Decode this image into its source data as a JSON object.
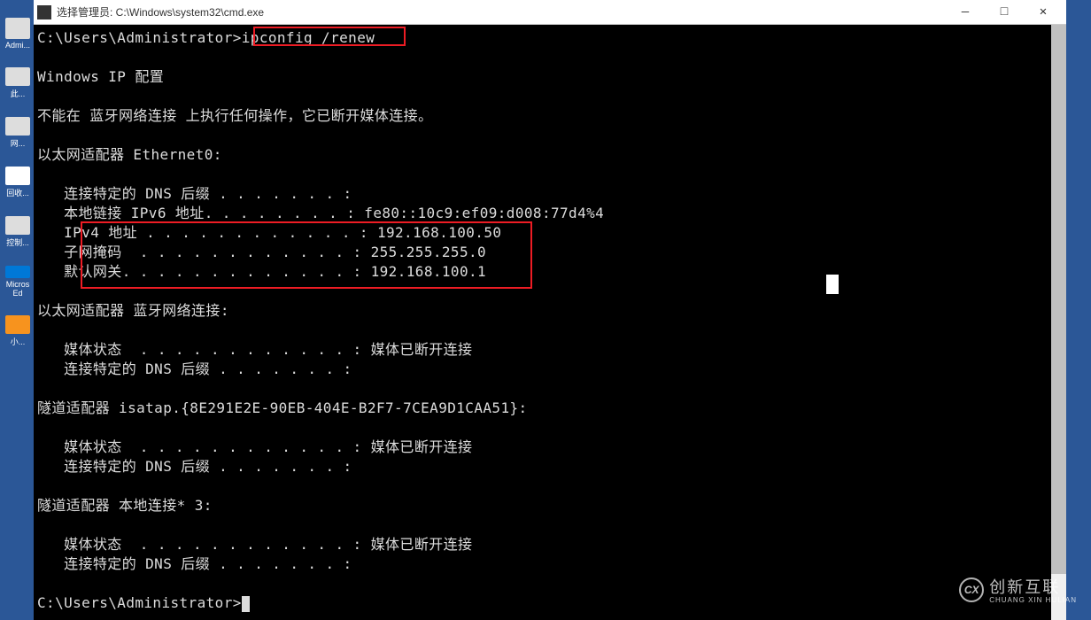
{
  "window": {
    "title": "选择管理员: C:\\Windows\\system32\\cmd.exe",
    "minimize_label": "—",
    "maximize_label": "□",
    "close_label": "✕"
  },
  "desktop": {
    "icons": [
      {
        "label": "Admi..."
      },
      {
        "label": "此..."
      },
      {
        "label": "网..."
      },
      {
        "label": "回收..."
      },
      {
        "label": "控制..."
      },
      {
        "label": "Micros\nEd"
      },
      {
        "label": "小..."
      }
    ]
  },
  "terminal": {
    "prompt1": "C:\\Users\\Administrator>",
    "command1": "ipconfig /renew",
    "blank1": "",
    "header": "Windows IP 配置",
    "blank2": "",
    "error_line": "不能在 蓝牙网络连接 上执行任何操作，它已断开媒体连接。",
    "blank3": "",
    "adapter1_title": "以太网适配器 Ethernet0:",
    "blank4": "",
    "adapter1_dns": "   连接特定的 DNS 后缀 . . . . . . . :",
    "adapter1_ipv6": "   本地链接 IPv6 地址. . . . . . . . : fe80::10c9:ef09:d008:77d4%4",
    "adapter1_ipv4": "   IPv4 地址 . . . . . . . . . . . . : 192.168.100.50",
    "adapter1_mask": "   子网掩码  . . . . . . . . . . . . : 255.255.255.0",
    "adapter1_gw": "   默认网关. . . . . . . . . . . . . : 192.168.100.1",
    "blank5": "",
    "adapter2_title": "以太网适配器 蓝牙网络连接:",
    "blank6": "",
    "adapter2_media": "   媒体状态  . . . . . . . . . . . . : 媒体已断开连接",
    "adapter2_dns": "   连接特定的 DNS 后缀 . . . . . . . :",
    "blank7": "",
    "adapter3_title": "隧道适配器 isatap.{8E291E2E-90EB-404E-B2F7-7CEA9D1CAA51}:",
    "blank8": "",
    "adapter3_media": "   媒体状态  . . . . . . . . . . . . : 媒体已断开连接",
    "adapter3_dns": "   连接特定的 DNS 后缀 . . . . . . . :",
    "blank9": "",
    "adapter4_title": "隧道适配器 本地连接* 3:",
    "blank10": "",
    "adapter4_media": "   媒体状态  . . . . . . . . . . . . : 媒体已断开连接",
    "adapter4_dns": "   连接特定的 DNS 后缀 . . . . . . . :",
    "blank11": "",
    "prompt2": "C:\\Users\\Administrator>"
  },
  "watermark": {
    "logo": "CX",
    "main": "创新互联",
    "sub": "CHUANG XIN HULIAN"
  }
}
